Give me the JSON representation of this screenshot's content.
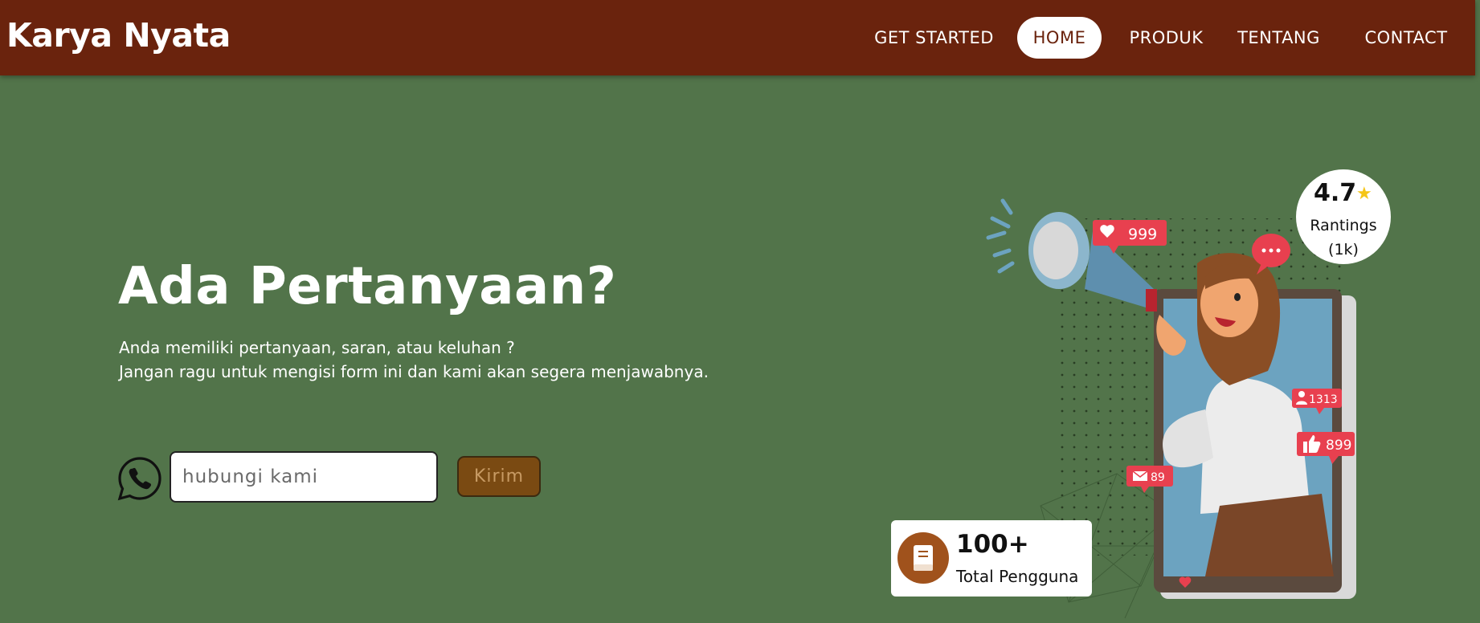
{
  "brand": "Karya Nyata",
  "nav": {
    "items": [
      {
        "label": "GET STARTED"
      },
      {
        "label": "HOME"
      },
      {
        "label": "PRODUK"
      },
      {
        "label": "TENTANG"
      },
      {
        "label": "CONTACT"
      }
    ],
    "active": "HOME"
  },
  "hero": {
    "title": "Ada Pertanyaan?",
    "subtitle_line1": "Anda memiliki pertanyaan, saran, atau keluhan ?",
    "subtitle_line2": "Jangan ragu untuk mengisi form ini dan kami akan segera menjawabnya."
  },
  "contact": {
    "icon": "whatsapp-icon",
    "placeholder": "hubungi kami",
    "value": "",
    "send_label": "Kirim"
  },
  "rating": {
    "value": "4.7",
    "label_line1": "Rantings",
    "label_line2": "(1k)"
  },
  "users": {
    "count": "100+",
    "label": "Total Pengguna"
  },
  "illustration": {
    "likes": "999",
    "followers": "1313",
    "thumbs": "899",
    "mails": "89"
  },
  "colors": {
    "background": "#52744A",
    "navbar": "#6A230D",
    "accent": "#A0521C",
    "badge": "#E8404F"
  }
}
